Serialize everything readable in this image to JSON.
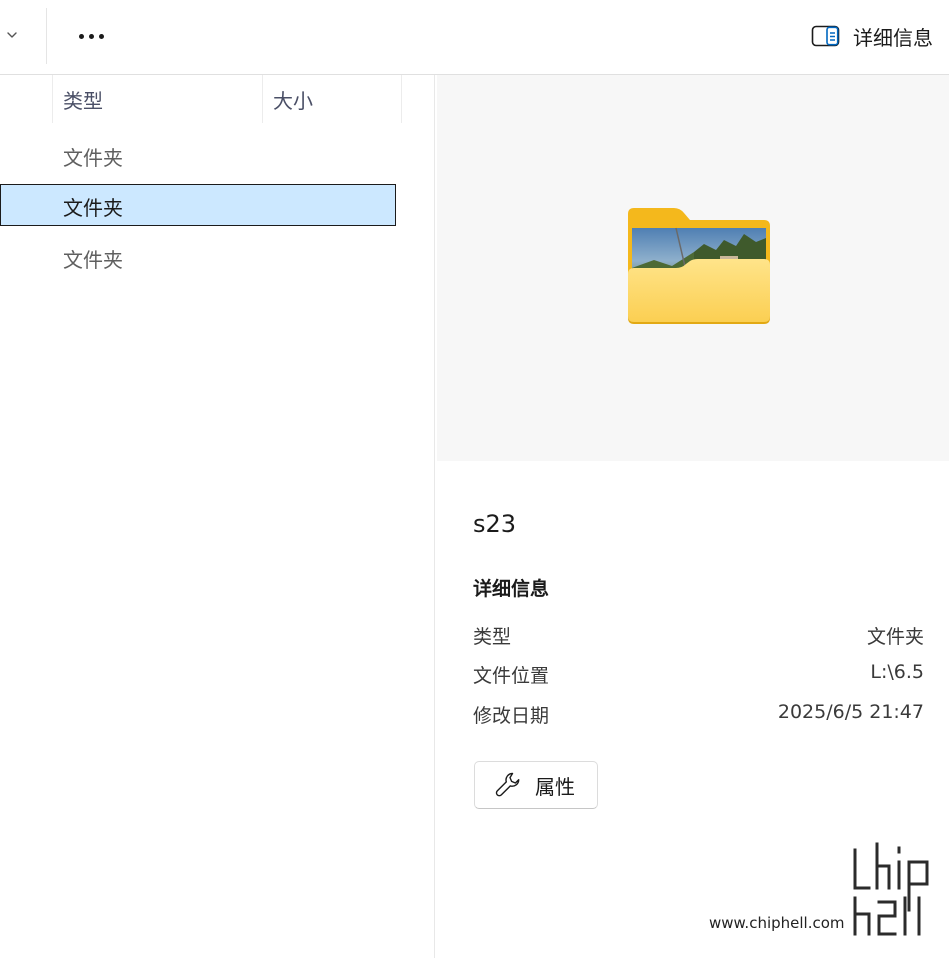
{
  "toolbar": {
    "chevron_icon": "chevron-down-icon",
    "more_icon": "more-horizontal-icon",
    "details_icon": "details-pane-icon",
    "details_label": "详细信息"
  },
  "file_list": {
    "columns": [
      {
        "label": "类型"
      },
      {
        "label": "大小"
      }
    ],
    "rows": [
      {
        "type": "文件夹",
        "selected": false
      },
      {
        "type": "文件夹",
        "selected": true
      },
      {
        "type": "文件夹",
        "selected": false
      }
    ]
  },
  "details": {
    "preview_icon": "folder-photo-icon",
    "name": "s23",
    "section_title": "详细信息",
    "properties": [
      {
        "label": "类型",
        "value": "文件夹"
      },
      {
        "label": "文件位置",
        "value": "L:\\6.5"
      },
      {
        "label": "修改日期",
        "value": "2025/6/5 21:47"
      }
    ],
    "properties_button": {
      "icon": "wrench-icon",
      "label": "属性"
    }
  },
  "watermark": {
    "text": "www.chiphell.com",
    "logo": "chiphell-logo"
  },
  "colors": {
    "selection_bg": "#cce8ff",
    "folder_yellow": "#f7c631",
    "accent": "#0067c0"
  }
}
